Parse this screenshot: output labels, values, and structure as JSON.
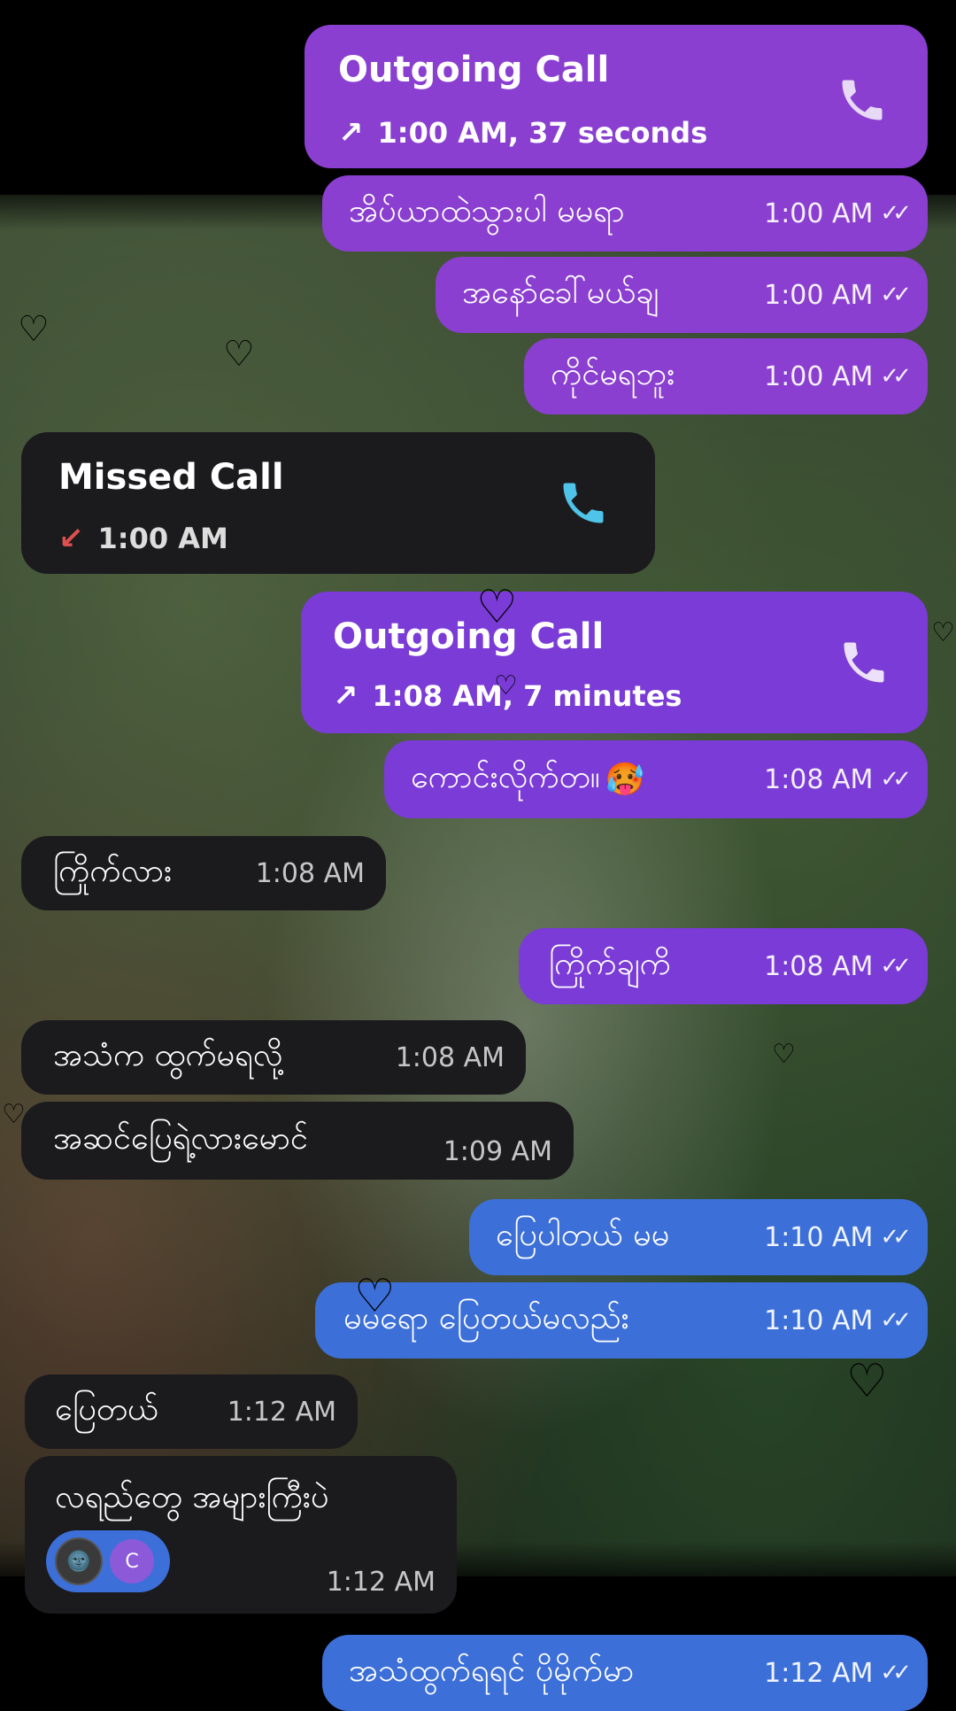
{
  "colors": {
    "outgoing_purple": "#8a3fd0",
    "outgoing_blue": "#3c6fd8",
    "incoming_dark": "#1b1b1e",
    "missed_arrow": "#e0504f",
    "phone_icon_incoming": "#4fc3e8"
  },
  "messages": [
    {
      "kind": "call",
      "title": "Outgoing Call",
      "subtitle": "1:00 AM, 37 seconds",
      "arrow_icon": "outgoing-arrow-icon",
      "icon": "phone-icon"
    },
    {
      "kind": "out",
      "text": "အိပ်ယာထဲသွားပါ မမရာ",
      "time": "1:00 AM",
      "status": "read-ticks-icon"
    },
    {
      "kind": "out",
      "text": "အနော်ခေါ်မယ်ချ",
      "time": "1:00 AM",
      "status": "read-ticks-icon"
    },
    {
      "kind": "out",
      "text": "ကိုင်မရဘူး",
      "time": "1:00 AM",
      "status": "read-ticks-icon"
    },
    {
      "kind": "call",
      "title": "Missed Call",
      "subtitle": "1:00 AM",
      "arrow_icon": "missed-arrow-icon",
      "icon": "phone-icon"
    },
    {
      "kind": "call",
      "title": "Outgoing Call",
      "subtitle": "1:08 AM, 7 minutes",
      "arrow_icon": "outgoing-arrow-icon",
      "icon": "phone-icon"
    },
    {
      "kind": "out",
      "text": "ကောင်းလိုက်တ။",
      "emoji": "🥵",
      "time": "1:08 AM",
      "status": "read-ticks-icon"
    },
    {
      "kind": "in",
      "text": "ကြိုက်လား",
      "time": "1:08 AM"
    },
    {
      "kind": "out",
      "text": "ကြိုက်ချကိ",
      "time": "1:08 AM",
      "status": "read-ticks-icon"
    },
    {
      "kind": "in",
      "text": "အသံက ထွက်မရလို့",
      "time": "1:08 AM"
    },
    {
      "kind": "in",
      "text": "အဆင်ပြေရဲ့လားမောင်",
      "time": "1:09 AM"
    },
    {
      "kind": "out",
      "text": "ပြေပါတယ် မမ",
      "time": "1:10 AM",
      "status": "read-ticks-icon"
    },
    {
      "kind": "out",
      "text": "မမရော ပြေတယ်မလည်း",
      "time": "1:10 AM",
      "status": "read-ticks-icon"
    },
    {
      "kind": "in",
      "text": "ပြေတယ်",
      "time": "1:12 AM"
    },
    {
      "kind": "in",
      "text": "လရည်တွေ အများကြီးပဲ",
      "time": "1:12 AM",
      "reactions": [
        "dark-moon-face-emoji",
        "C"
      ]
    },
    {
      "kind": "out",
      "text": "အသံထွက်ရရင် ပိုမိုက်မာ",
      "time": "1:12 AM",
      "status": "read-ticks-icon"
    }
  ],
  "decor": {
    "heart_glyph": "♡"
  }
}
